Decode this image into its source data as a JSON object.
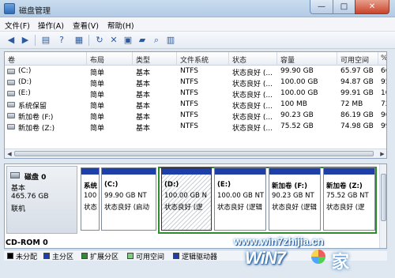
{
  "window": {
    "title": "磁盘管理",
    "min": "—",
    "max": "□",
    "close": "✕"
  },
  "menu": [
    "文件(F)",
    "操作(A)",
    "查看(V)",
    "帮助(H)"
  ],
  "toolbar": {
    "icons": [
      "back-icon",
      "forward-icon",
      "list-view-icon",
      "help-icon",
      "refresh-icon",
      "delete-icon",
      "properties-icon",
      "open-folder-icon",
      "search-icon",
      "console-icon"
    ]
  },
  "table": {
    "columns": [
      "卷",
      "布局",
      "类型",
      "文件系统",
      "状态",
      "容量",
      "可用空间",
      "%"
    ],
    "rows": [
      {
        "vol": "(C:)",
        "layout": "简单",
        "type": "基本",
        "fs": "NTFS",
        "status": "状态良好 (...",
        "cap": "99.90 GB",
        "free": "65.97 GB",
        "pct": "66"
      },
      {
        "vol": "(D:)",
        "layout": "简单",
        "type": "基本",
        "fs": "NTFS",
        "status": "状态良好 (...",
        "cap": "100.00 GB",
        "free": "94.87 GB",
        "pct": "95"
      },
      {
        "vol": "(E:)",
        "layout": "简单",
        "type": "基本",
        "fs": "NTFS",
        "status": "状态良好 (...",
        "cap": "100.00 GB",
        "free": "99.91 GB",
        "pct": "10"
      },
      {
        "vol": "系统保留",
        "layout": "简单",
        "type": "基本",
        "fs": "NTFS",
        "status": "状态良好 (...",
        "cap": "100 MB",
        "free": "72 MB",
        "pct": "72"
      },
      {
        "vol": "新加卷 (F:)",
        "layout": "简单",
        "type": "基本",
        "fs": "NTFS",
        "status": "状态良好 (...",
        "cap": "90.23 GB",
        "free": "86.19 GB",
        "pct": "96"
      },
      {
        "vol": "新加卷 (Z:)",
        "layout": "简单",
        "type": "基本",
        "fs": "NTFS",
        "status": "状态良好 (...",
        "cap": "75.52 GB",
        "free": "74.98 GB",
        "pct": "99"
      }
    ]
  },
  "disk": {
    "name": "磁盘 0",
    "type": "基本",
    "size": "465.76 GB",
    "state": "联机"
  },
  "partitions": [
    {
      "title": "系统",
      "size": "100",
      "status": "状态",
      "color": "#1f3fa8"
    },
    {
      "title": "(C:)",
      "size": "99.90 GB NT",
      "status": "状态良好 (启动",
      "color": "#1f3fa8"
    },
    {
      "title": "(D:)",
      "size": "100.00 GB N",
      "status": "状态良好 (逻",
      "color": "#1f3fa8",
      "selected": true
    },
    {
      "title": "(E:)",
      "size": "100.00 GB NT",
      "status": "状态良好 (逻辑",
      "color": "#1f3fa8"
    },
    {
      "title": "新加卷 (F:)",
      "size": "90.23 GB NT",
      "status": "状态良好 (逻辑",
      "color": "#1f3fa8"
    },
    {
      "title": "新加卷 (Z:)",
      "size": "75.52 GB NT",
      "status": "状态良好 (逻",
      "color": "#1f3fa8"
    }
  ],
  "cdrom": "CD-ROM 0",
  "legend": [
    {
      "label": "未分配",
      "color": "#000000"
    },
    {
      "label": "主分区",
      "color": "#1f3fa8"
    },
    {
      "label": "扩展分区",
      "color": "#2e8b2e"
    },
    {
      "label": "可用空间",
      "color": "#7fd07f"
    },
    {
      "label": "逻辑驱动器",
      "color": "#1f3fa8"
    }
  ],
  "watermark": {
    "url": "www.win7zhijia.cn",
    "logo": "WiN7",
    "zh": "家"
  }
}
